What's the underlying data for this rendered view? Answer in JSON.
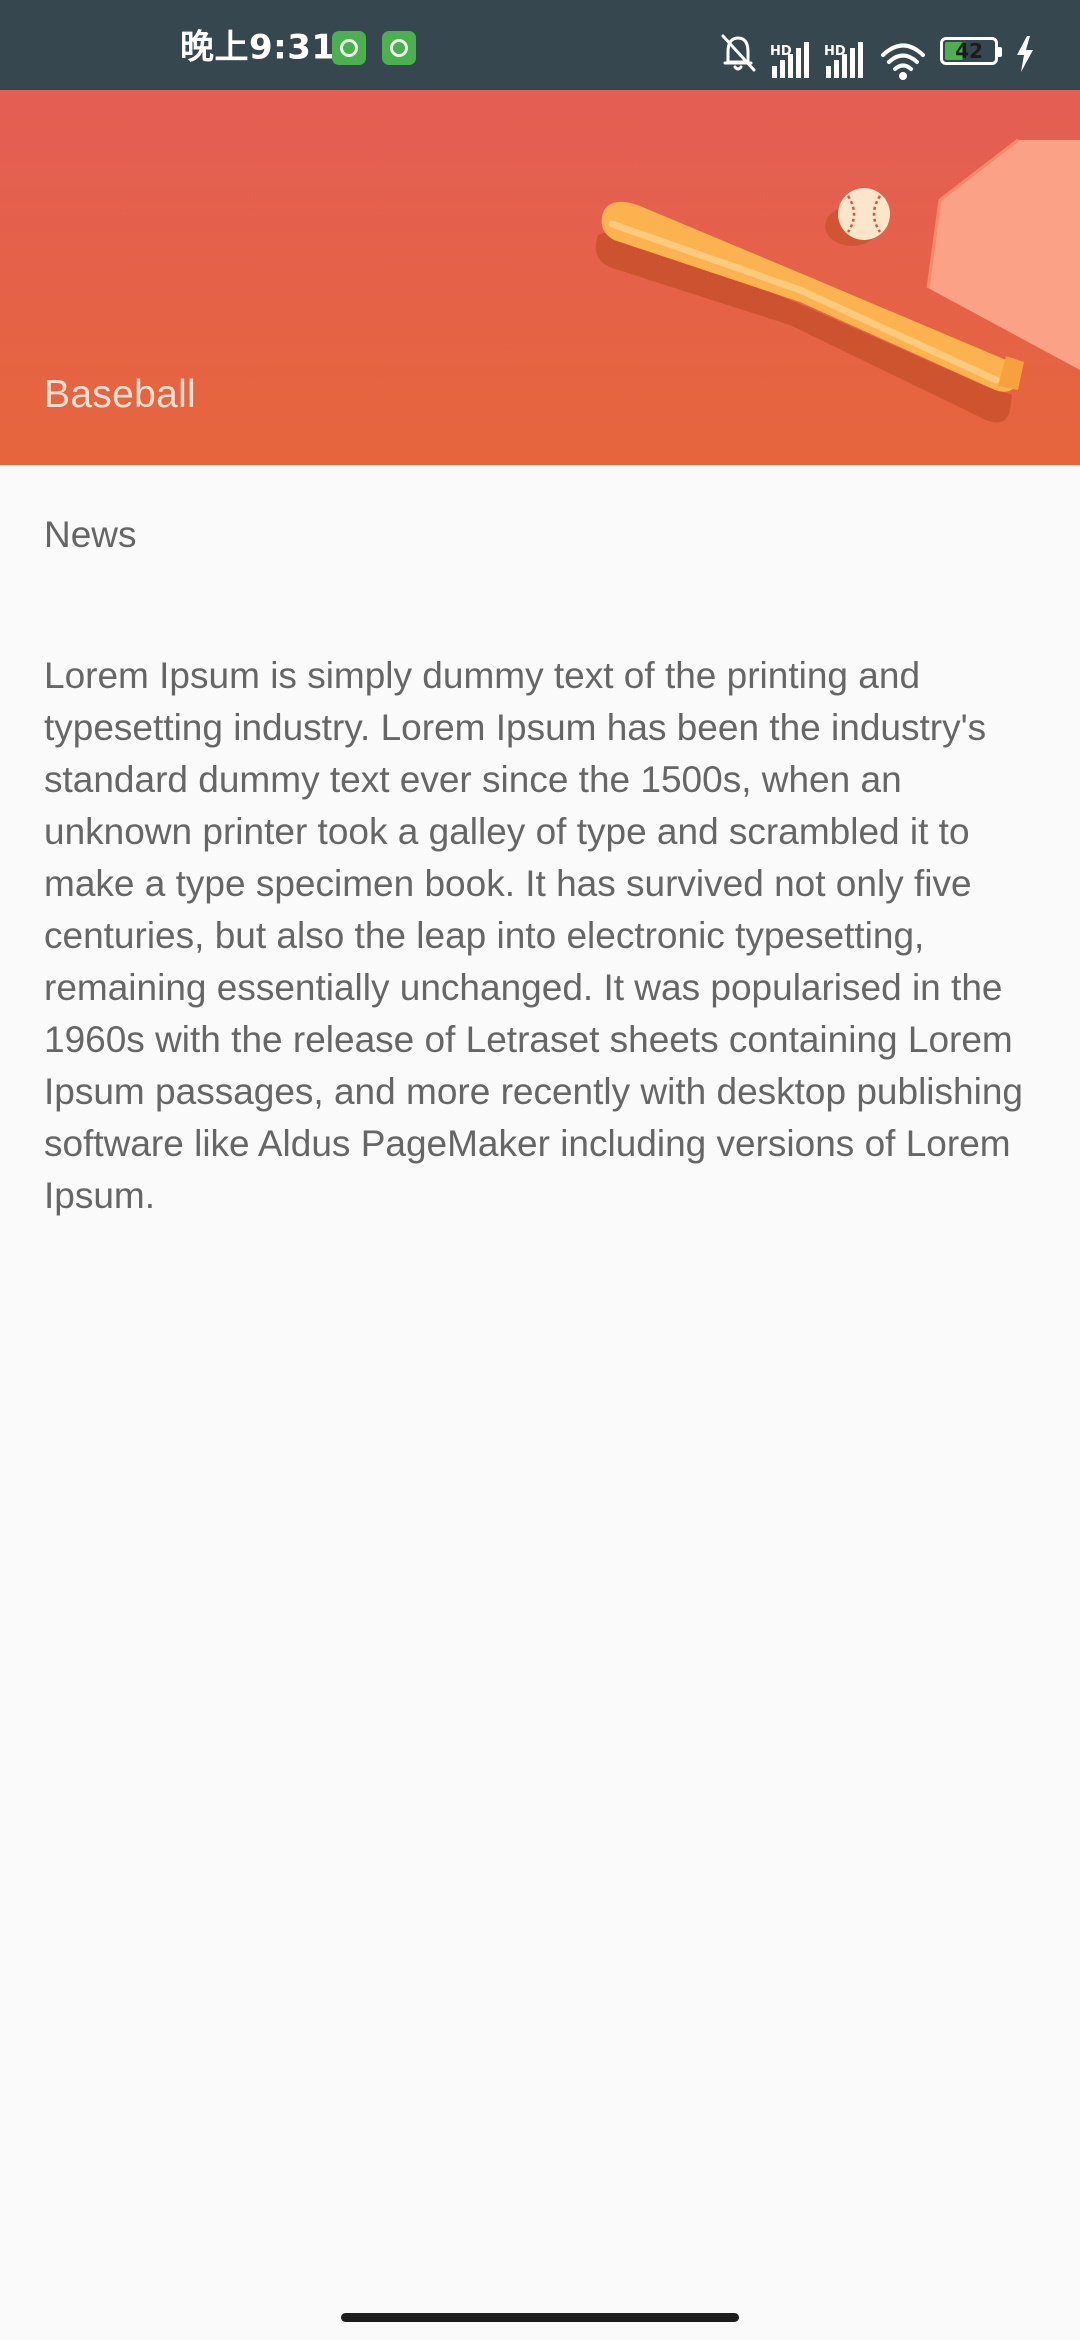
{
  "status_bar": {
    "time": "晚上9:31",
    "battery_level": "42",
    "battery_fraction": 0.42,
    "icons": [
      "app-badge-icon",
      "app-badge-icon",
      "alarm-off-icon",
      "hd-signal-icon",
      "hd-signal-icon",
      "wifi-icon",
      "battery-icon",
      "charging-bolt-icon"
    ]
  },
  "header": {
    "title": "Baseball",
    "illustration": [
      "baseball-bat-icon",
      "baseball-icon",
      "home-plate-icon"
    ],
    "colors": {
      "top": "#e45e55",
      "bottom": "#e6653c"
    }
  },
  "content": {
    "section_label": "News",
    "body": "Lorem Ipsum is simply dummy text of the printing and typesetting industry. Lorem Ipsum has been the industry's standard dummy text ever since the 1500s, when an unknown printer took a galley of type and scrambled it to make a type specimen book. It has survived not only five centuries, but also the leap into electronic typesetting, remaining essentially unchanged. It was popularised in the 1960s with the release of Letraset sheets containing Lorem Ipsum passages, and more recently with desktop publishing software like Aldus PageMaker including versions of Lorem Ipsum."
  }
}
